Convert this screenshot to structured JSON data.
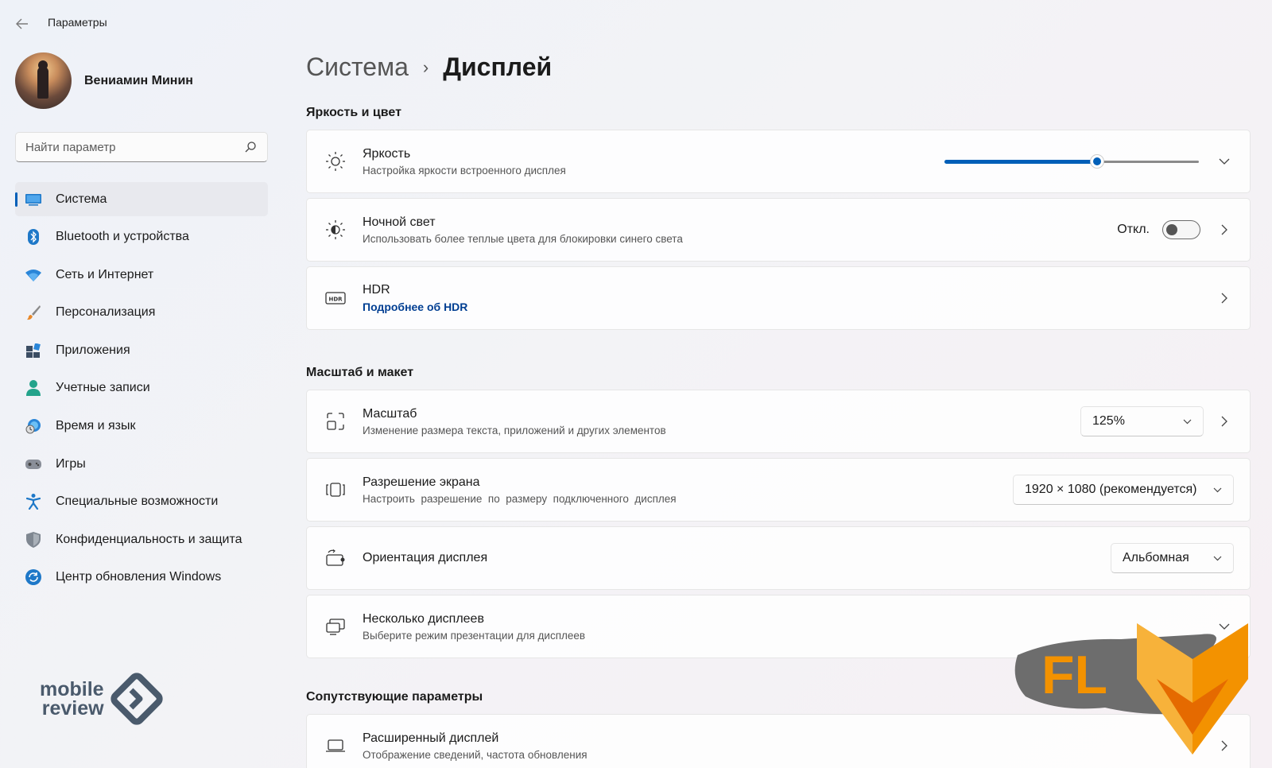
{
  "app": {
    "title": "Параметры"
  },
  "profile": {
    "name": "Вениамин Минин"
  },
  "search": {
    "placeholder": "Найти параметр"
  },
  "sidebar": {
    "items": [
      {
        "label": "Система",
        "icon": "monitor-icon",
        "active": true
      },
      {
        "label": "Bluetooth и устройства",
        "icon": "bluetooth-icon"
      },
      {
        "label": "Сеть и Интернет",
        "icon": "wifi-icon"
      },
      {
        "label": "Персонализация",
        "icon": "brush-icon"
      },
      {
        "label": "Приложения",
        "icon": "apps-icon"
      },
      {
        "label": "Учетные записи",
        "icon": "account-icon"
      },
      {
        "label": "Время и язык",
        "icon": "globe-clock-icon"
      },
      {
        "label": "Игры",
        "icon": "gamepad-icon"
      },
      {
        "label": "Специальные возможности",
        "icon": "accessibility-icon"
      },
      {
        "label": "Конфиденциальность и защита",
        "icon": "shield-icon"
      },
      {
        "label": "Центр обновления Windows",
        "icon": "update-icon"
      }
    ]
  },
  "breadcrumb": {
    "parent": "Система",
    "separator": "›",
    "current": "Дисплей"
  },
  "sections": {
    "brightness_color": "Яркость и цвет",
    "scale_layout": "Масштаб и макет",
    "related": "Сопутствующие параметры"
  },
  "cards": {
    "brightness": {
      "title": "Яркость",
      "subtitle": "Настройка яркости встроенного дисплея",
      "value": 0.6
    },
    "night_light": {
      "title": "Ночной свет",
      "subtitle": "Использовать более теплые цвета для блокировки синего света",
      "state_label": "Откл.",
      "on": false
    },
    "hdr": {
      "title": "HDR",
      "link": "Подробнее об HDR"
    },
    "scale": {
      "title": "Масштаб",
      "subtitle": "Изменение размера текста, приложений и других элементов",
      "value": "125%"
    },
    "resolution": {
      "title": "Разрешение экрана",
      "subtitle": "Настроить  разрешение  по  размеру  подключенного  дисплея",
      "value": "1920 × 1080 (рекомендуется)"
    },
    "orientation": {
      "title": "Ориентация дисплея",
      "value": "Альбомная"
    },
    "multi_display": {
      "title": "Несколько дисплеев",
      "subtitle": "Выберите режим презентации для дисплеев"
    },
    "extended": {
      "title": "Расширенный дисплей",
      "subtitle": "Отображение сведений, частота обновления"
    }
  },
  "watermarks": {
    "left_line1": "mobile",
    "left_line2": "review"
  },
  "colors": {
    "accent": "#005fb8",
    "link": "#003e92",
    "fl_orange": "#f39200",
    "fl_grey": "#6d6d6d"
  }
}
